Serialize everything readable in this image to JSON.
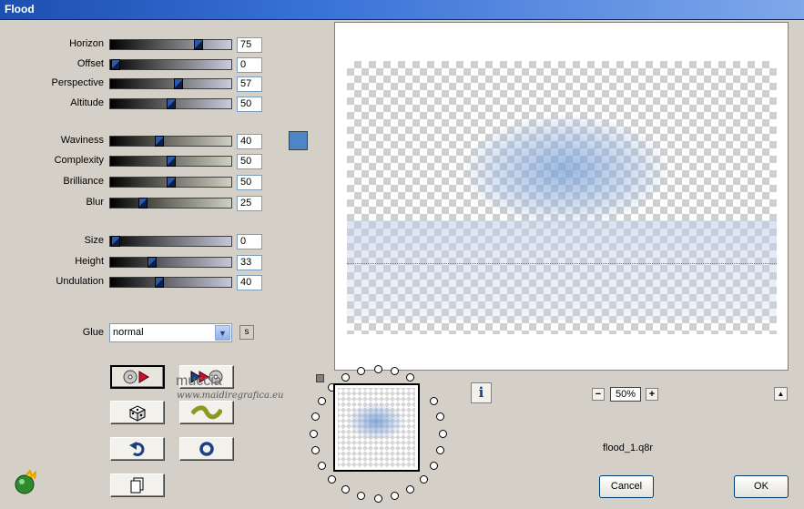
{
  "window": {
    "title": "Flood"
  },
  "sliders": [
    {
      "label": "Horizon",
      "value": "75",
      "fraction": 0.75
    },
    {
      "label": "Offset",
      "value": "0",
      "fraction": 0.0
    },
    {
      "label": "Perspective",
      "value": "57",
      "fraction": 0.57
    },
    {
      "label": "Altitude",
      "value": "50",
      "fraction": 0.5
    },
    {
      "label": "Waviness",
      "value": "40",
      "fraction": 0.4
    },
    {
      "label": "Complexity",
      "value": "50",
      "fraction": 0.5
    },
    {
      "label": "Brilliance",
      "value": "50",
      "fraction": 0.5
    },
    {
      "label": "Blur",
      "value": "25",
      "fraction": 0.25
    },
    {
      "label": "Size",
      "value": "0",
      "fraction": 0.0
    },
    {
      "label": "Height",
      "value": "33",
      "fraction": 0.33
    },
    {
      "label": "Undulation",
      "value": "40",
      "fraction": 0.4
    }
  ],
  "color_swatch": "#4c86c6",
  "glue": {
    "label": "Glue",
    "value": "normal",
    "side_button": "s"
  },
  "tools": [
    {
      "name": "random-button-icon",
      "icon": "cd-play-icon"
    },
    {
      "name": "mirror-cd-icon",
      "icon": "play-cd-icon"
    },
    {
      "name": "dice-icon",
      "icon": "dice-icon"
    },
    {
      "name": "wave-icon",
      "icon": "wave-icon"
    },
    {
      "name": "undo-icon",
      "icon": "undo-arrow-icon"
    },
    {
      "name": "reset-icon",
      "icon": "ring-icon"
    },
    {
      "name": "copy-icon",
      "icon": "copy-page-icon"
    }
  ],
  "preview": {
    "zoom": "50%",
    "info_label": "i",
    "filename": "flood_1.q8r"
  },
  "buttons": {
    "cancel": "Cancel",
    "ok": "OK"
  },
  "watermark": {
    "name": "muccia",
    "url": "www.maidiregrafica.eu"
  }
}
